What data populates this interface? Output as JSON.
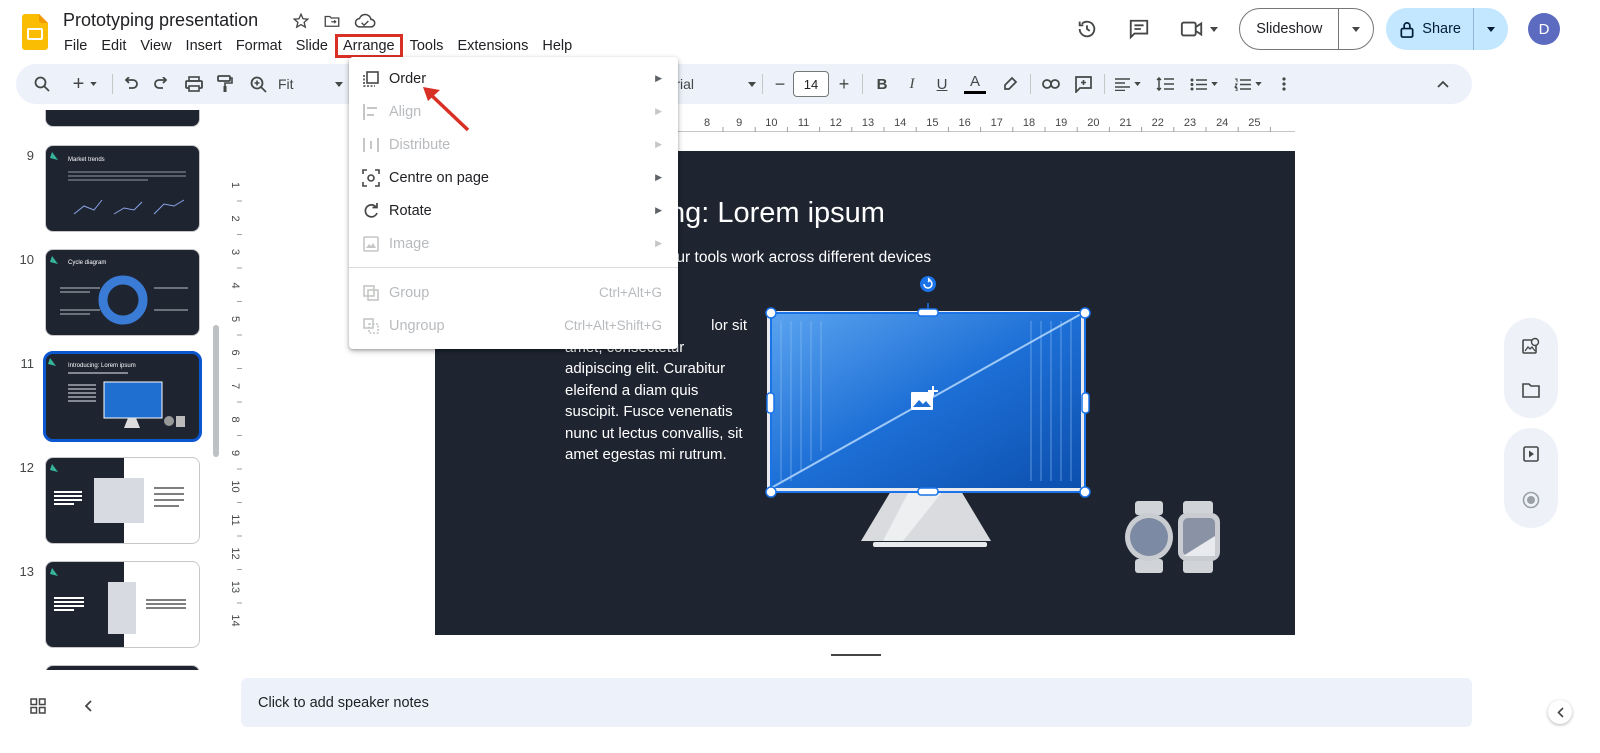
{
  "header": {
    "title": "Prototyping presentation",
    "menus": [
      "File",
      "Edit",
      "View",
      "Insert",
      "Format",
      "Slide",
      "Arrange",
      "Tools",
      "Extensions",
      "Help"
    ],
    "active_menu": "Arrange",
    "slideshow_label": "Slideshow",
    "share_label": "Share",
    "avatar_letter": "D"
  },
  "toolbar": {
    "zoom_label": "Fit",
    "font_name": "Arial",
    "font_size": "14"
  },
  "filmstrip": {
    "slides": [
      {
        "number": "9",
        "title": "Market trends"
      },
      {
        "number": "10",
        "title": "Cycle diagram"
      },
      {
        "number": "11",
        "title": "Introducing: Lorem ipsum",
        "selected": true
      },
      {
        "number": "12",
        "title": ""
      },
      {
        "number": "13",
        "title": ""
      }
    ]
  },
  "slide": {
    "title_visible": "cing: Lorem ipsum",
    "subtitle_visible": "y your tools work across different devices",
    "body_line1": "lor sit",
    "body_rest": "amet, consectetur adipiscing elit. Curabitur eleifend a diam quis suscipit. Fusce venenatis nunc ut lectus convallis, sit amet egestas mi rutrum."
  },
  "ruler": {
    "h_ticks": [
      "8",
      "9",
      "10",
      "11",
      "12",
      "13",
      "14",
      "15",
      "16",
      "17",
      "18",
      "19",
      "20",
      "21",
      "22",
      "23",
      "24",
      "25"
    ],
    "v_ticks": [
      "1",
      "2",
      "3",
      "4",
      "5",
      "6",
      "7",
      "8",
      "9",
      "10",
      "11",
      "12",
      "13",
      "14"
    ]
  },
  "arrange_menu": {
    "items": [
      {
        "label": "Order",
        "icon": "order-icon",
        "submenu": true,
        "disabled": false
      },
      {
        "label": "Align",
        "icon": "align-icon",
        "submenu": true,
        "disabled": true
      },
      {
        "label": "Distribute",
        "icon": "distribute-icon",
        "submenu": true,
        "disabled": true
      },
      {
        "label": "Centre on page",
        "icon": "centre-icon",
        "submenu": true,
        "disabled": false
      },
      {
        "label": "Rotate",
        "icon": "rotate-icon",
        "submenu": true,
        "disabled": false
      },
      {
        "label": "Image",
        "icon": "image-icon",
        "submenu": true,
        "disabled": true
      },
      {
        "label": "Group",
        "icon": "group-icon",
        "shortcut": "Ctrl+Alt+G",
        "disabled": true
      },
      {
        "label": "Ungroup",
        "icon": "ungroup-icon",
        "shortcut": "Ctrl+Alt+Shift+G",
        "disabled": true
      }
    ]
  },
  "notes": {
    "placeholder": "Click to add speaker notes"
  },
  "colors": {
    "accent": "#0b57d0",
    "annotation": "#d93025",
    "slide_bg": "#1e2430",
    "share_bg": "#c2e7ff"
  }
}
